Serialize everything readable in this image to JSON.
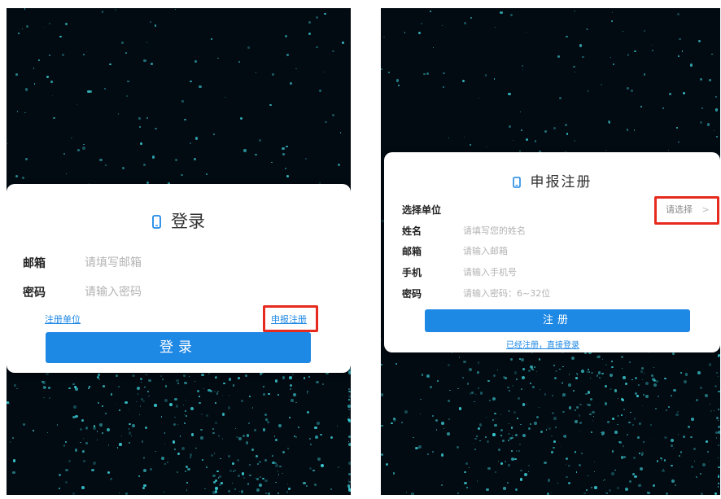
{
  "login": {
    "title": "登录",
    "email_label": "邮箱",
    "email_placeholder": "请填写邮箱",
    "password_label": "密码",
    "password_placeholder": "请输入密码",
    "register_unit_link": "注册单位",
    "apply_register_link": "申报注册",
    "login_button": "登录"
  },
  "register": {
    "title": "申报注册",
    "unit_label": "选择单位",
    "unit_select": "请选择",
    "unit_chevron": ">",
    "name_label": "姓名",
    "name_placeholder": "请填写您的姓名",
    "email_label": "邮箱",
    "email_placeholder": "请输入邮箱",
    "phone_label": "手机",
    "phone_placeholder": "请输入手机号",
    "password_label": "密码",
    "password_placeholder": "请输入密码：6~32位",
    "register_button": "注册",
    "already_registered_link": "已经注册，直接登录"
  },
  "colors": {
    "accent": "#1e88e5",
    "highlight": "#e62a1e",
    "background": "#020a12",
    "particle": "#3fd8e0"
  },
  "icons": [
    "phone-icon",
    "chevron-right-icon"
  ]
}
